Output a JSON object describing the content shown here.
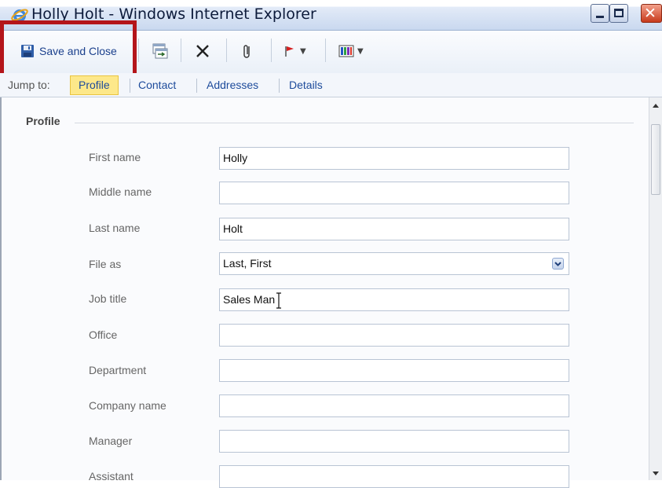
{
  "window": {
    "title": "Holly Holt - Windows Internet Explorer"
  },
  "toolbar": {
    "save_close_label": "Save and Close",
    "buttons": [
      {
        "icon": "save-icon"
      },
      {
        "icon": "open-new-window-icon"
      },
      {
        "icon": "delete-icon"
      },
      {
        "icon": "attach-icon"
      },
      {
        "icon": "flag-icon"
      },
      {
        "icon": "categorize-icon"
      }
    ]
  },
  "jump_bar": {
    "label": "Jump to:",
    "links": [
      "Profile",
      "Contact",
      "Addresses",
      "Details"
    ],
    "active": "Profile"
  },
  "profile": {
    "section_title": "Profile",
    "fields": [
      {
        "label": "First name",
        "value": "Holly"
      },
      {
        "label": "Middle name",
        "value": ""
      },
      {
        "label": "Last name",
        "value": "Holt"
      },
      {
        "label": "File as",
        "value": "Last, First"
      },
      {
        "label": "Job title",
        "value": "Sales Man"
      },
      {
        "label": "Office",
        "value": ""
      },
      {
        "label": "Department",
        "value": ""
      },
      {
        "label": "Company name",
        "value": ""
      },
      {
        "label": "Manager",
        "value": ""
      },
      {
        "label": "Assistant",
        "value": ""
      }
    ]
  },
  "colors": {
    "highlight_box": "#b4151a",
    "active_tab": "#fde88a",
    "link": "#1d4b9b"
  }
}
